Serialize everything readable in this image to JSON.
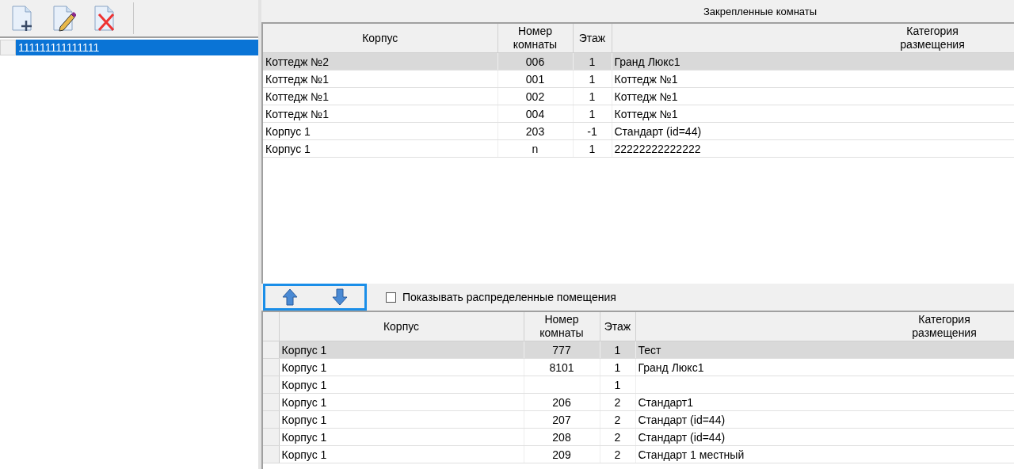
{
  "left_panel": {
    "toolbar": [
      {
        "kind": "add"
      },
      {
        "kind": "edit"
      },
      {
        "kind": "delete"
      }
    ],
    "items": [
      {
        "label": "111111111111111",
        "selected": true
      }
    ]
  },
  "assigned_rooms": {
    "title": "Закрепленные комнаты",
    "columns": [
      "Корпус",
      "Номер комнаты",
      "Этаж",
      "Категория размещения"
    ],
    "rows": [
      {
        "cells": [
          "Коттедж №2",
          "006",
          "1",
          "Гранд Люкс1"
        ],
        "selected": true
      },
      {
        "cells": [
          "Коттедж №1",
          "001",
          "1",
          "Коттедж №1"
        ],
        "selected": false
      },
      {
        "cells": [
          "Коттедж №1",
          "002",
          "1",
          "Коттедж №1"
        ],
        "selected": false
      },
      {
        "cells": [
          "Коттедж №1",
          "004",
          "1",
          "Коттедж №1"
        ],
        "selected": false
      },
      {
        "cells": [
          "Корпус 1",
          "203",
          "-1",
          "Стандарт (id=44)"
        ],
        "selected": false
      },
      {
        "cells": [
          "Корпус 1",
          "n",
          "1",
          "22222222222222"
        ],
        "selected": false
      }
    ]
  },
  "move_buttons": [
    {
      "kind": "up"
    },
    {
      "kind": "down"
    }
  ],
  "show_distributed": {
    "label": "Показывать распределенные помещения",
    "checked": false
  },
  "free_rooms": {
    "columns": [
      "Корпус",
      "Номер комнаты",
      "Этаж",
      "Категория размещения"
    ],
    "rows": [
      {
        "cells": [
          "Корпус 1",
          "777",
          "1",
          "Тест"
        ],
        "selected": true
      },
      {
        "cells": [
          "Корпус 1",
          "8101",
          "1",
          "Гранд Люкс1"
        ],
        "selected": false
      },
      {
        "cells": [
          "Корпус 1",
          "",
          "1",
          ""
        ],
        "selected": false
      },
      {
        "cells": [
          "Корпус 1",
          "206",
          "2",
          "Стандарт1"
        ],
        "selected": false
      },
      {
        "cells": [
          "Корпус 1",
          "207",
          "2",
          "Стандарт (id=44)"
        ],
        "selected": false
      },
      {
        "cells": [
          "Корпус 1",
          "208",
          "2",
          "Стандарт (id=44)"
        ],
        "selected": false
      },
      {
        "cells": [
          "Корпус 1",
          "209",
          "2",
          "Стандарт 1 местный"
        ],
        "selected": false
      }
    ]
  }
}
